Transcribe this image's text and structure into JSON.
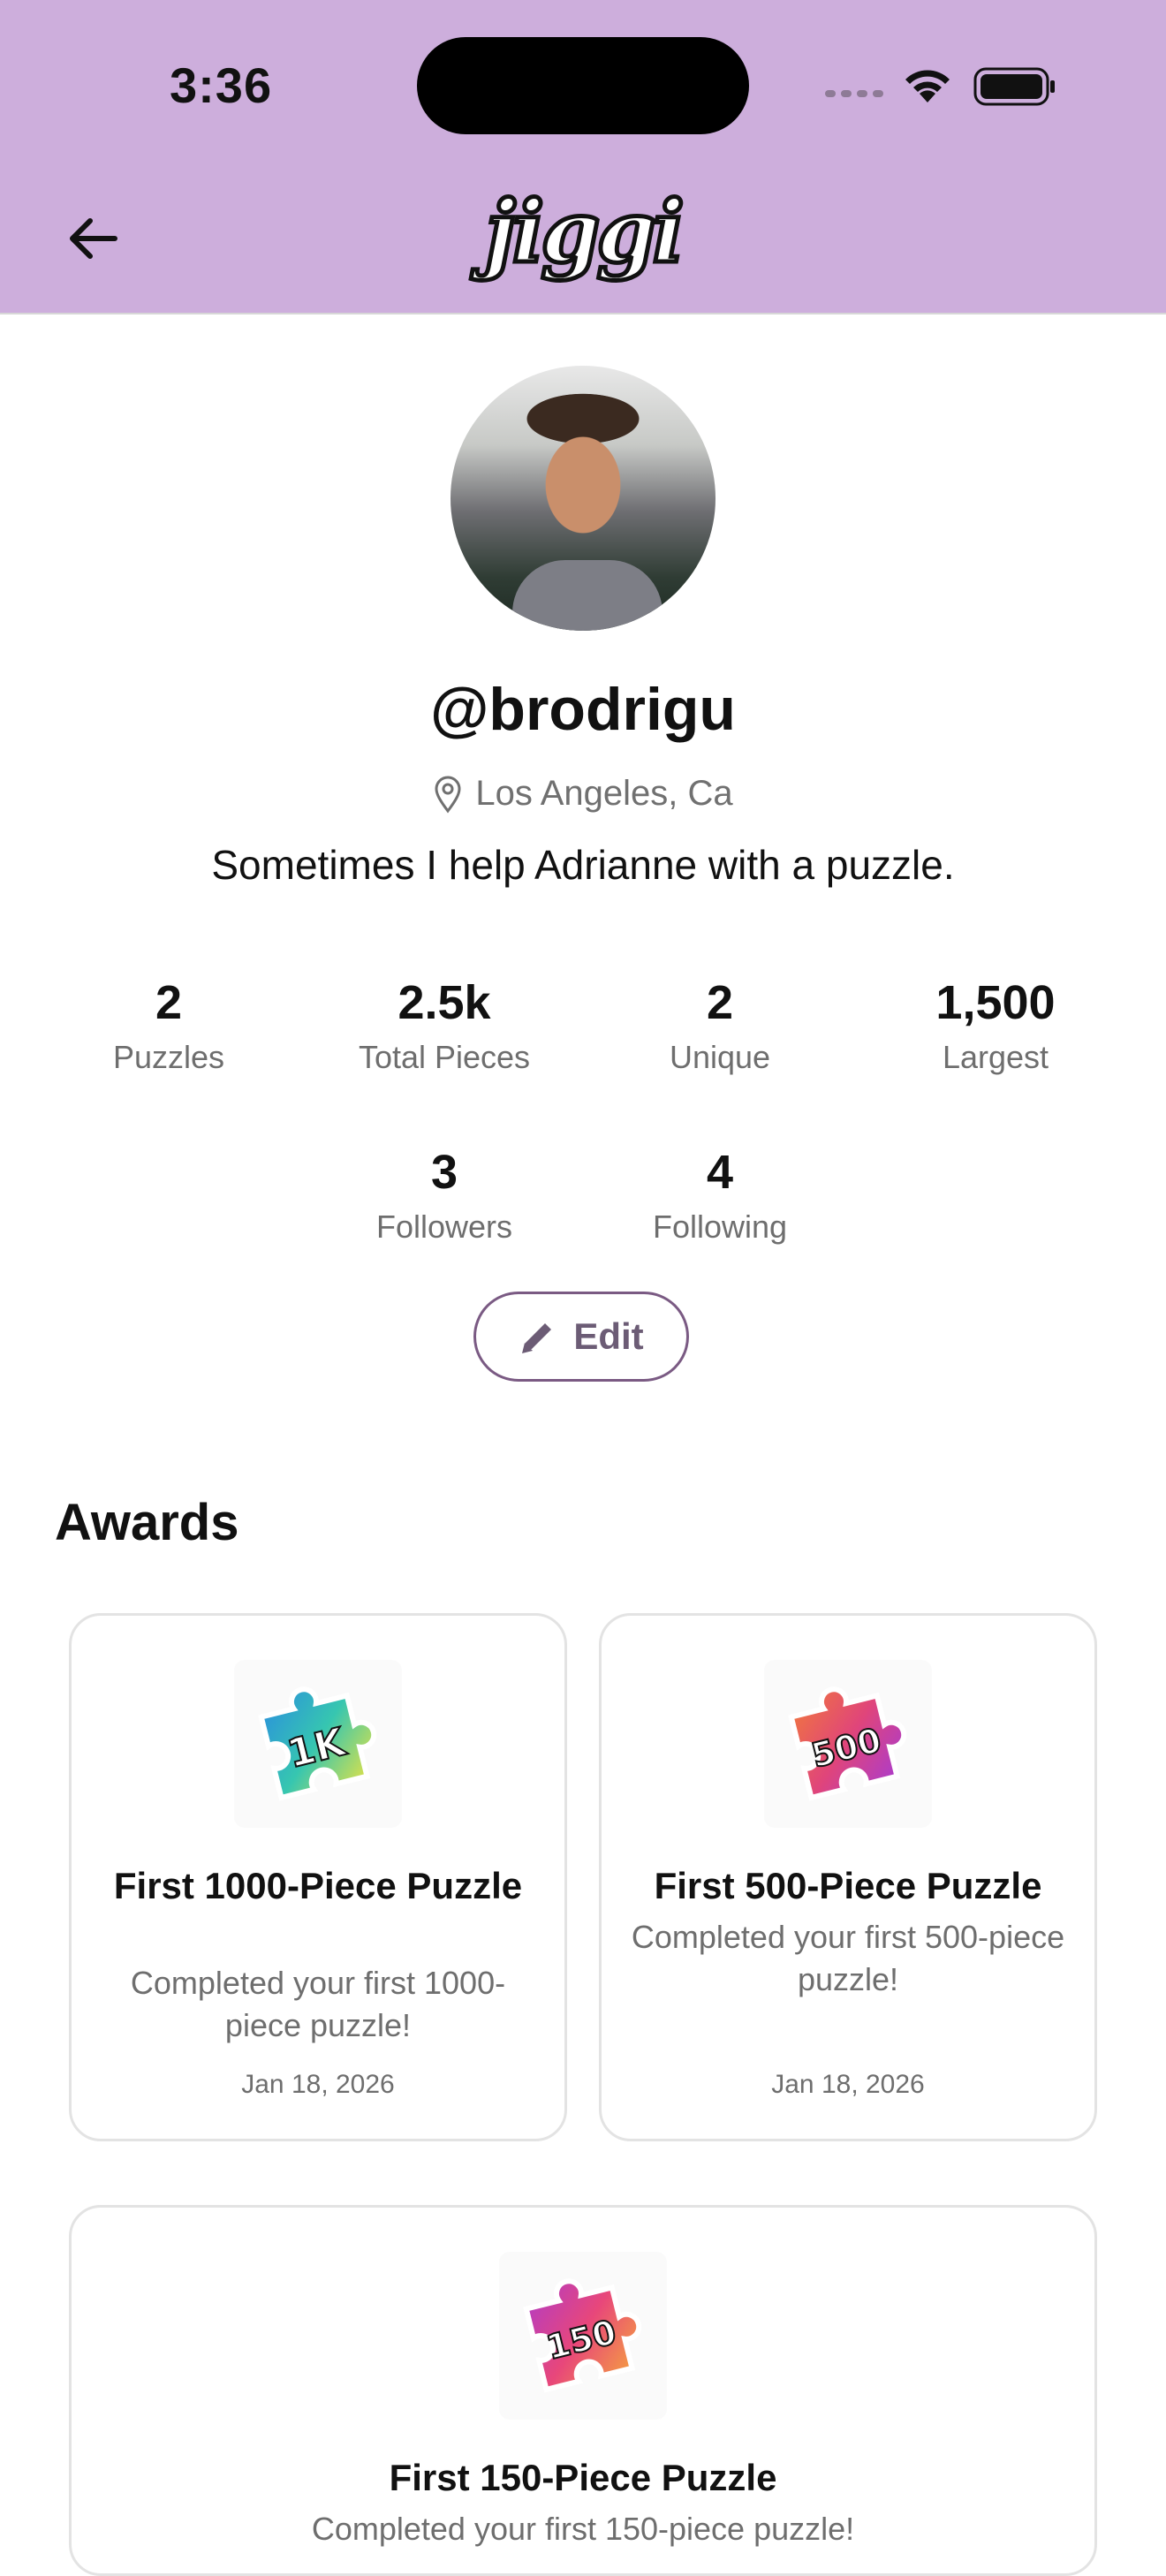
{
  "status_bar": {
    "time": "3:36"
  },
  "header": {
    "logo_text": "jiggi",
    "back_icon": "arrow-left-icon"
  },
  "profile": {
    "username": "@brodrigu",
    "location": "Los Angeles, Ca",
    "bio": "Sometimes I help Adrianne with a puzzle.",
    "stats": [
      {
        "value": "2",
        "label": "Puzzles"
      },
      {
        "value": "2.5k",
        "label": "Total Pieces"
      },
      {
        "value": "2",
        "label": "Unique"
      },
      {
        "value": "1,500",
        "label": "Largest"
      },
      {
        "value": "3",
        "label": "Followers"
      },
      {
        "value": "4",
        "label": "Following"
      }
    ],
    "edit_label": "Edit"
  },
  "awards": {
    "title": "Awards",
    "items": [
      {
        "badge": "1K",
        "badge_colors": [
          "#2a8de0",
          "#f6e53a"
        ],
        "title": "First 1000-Piece Puzzle",
        "description": "Completed your first 1000-piece puzzle!",
        "date": "Jan 18, 2026"
      },
      {
        "badge": "500",
        "badge_colors": [
          "#f27a3a",
          "#a43ad8"
        ],
        "title": "First 500-Piece Puzzle",
        "description": "Completed your first 500-piece puzzle!",
        "date": "Jan 18, 2026"
      },
      {
        "badge": "150",
        "badge_colors": [
          "#b13bc8",
          "#f6a93a"
        ],
        "title": "First 150-Piece Puzzle",
        "description": "Completed your first 150-piece puzzle!"
      }
    ]
  },
  "colors": {
    "header_bg": "#cdaedc",
    "accent": "#7a5a83"
  }
}
